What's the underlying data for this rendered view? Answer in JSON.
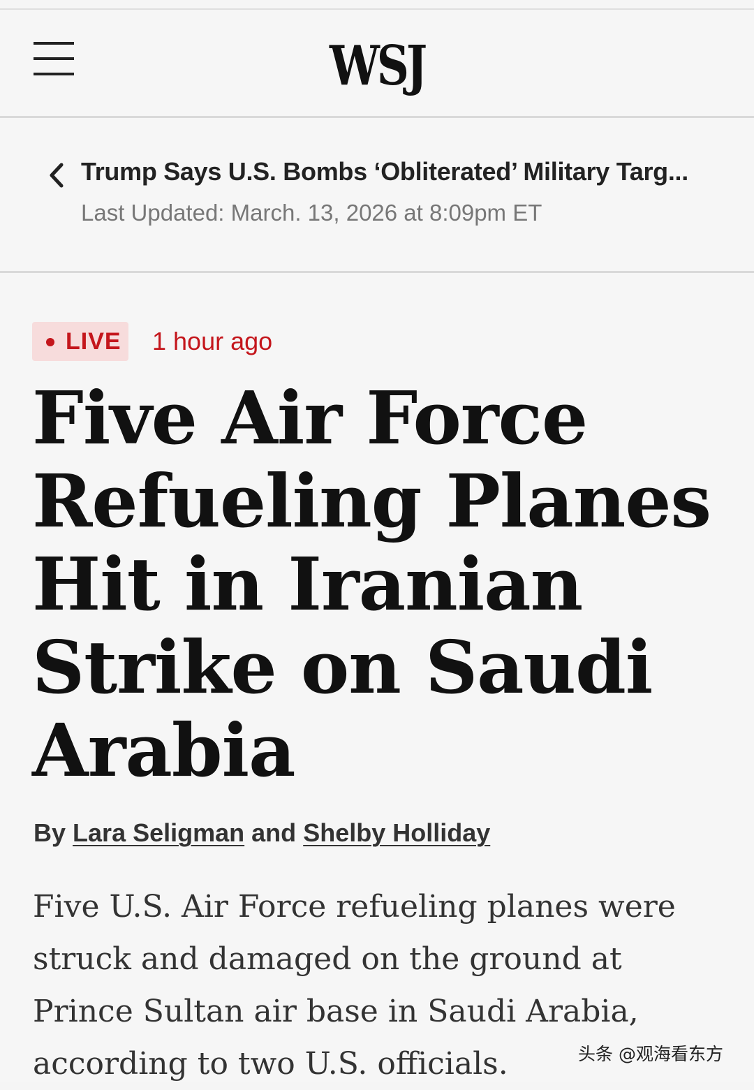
{
  "header": {
    "logo": "WSJ",
    "menu_icon": "hamburger-menu-icon"
  },
  "back_bar": {
    "icon": "chevron-left-icon",
    "title": "Trump Says U.S. Bombs ‘Obliterated’ Military Targ...",
    "updated": "Last Updated: March. 13, 2026 at 8:09pm ET"
  },
  "article": {
    "live_label": "LIVE",
    "time_ago": "1 hour ago",
    "headline": "Five Air Force Refueling Planes Hit in Iranian Strike on Saudi Arabia",
    "byline": {
      "prefix": "By",
      "author1": "Lara Seligman",
      "joiner": "and",
      "author2": "Shelby Holliday"
    },
    "lede": "Five U.S. Air Force refueling planes were struck and damaged on the ground at Prince Sultan air base in Saudi Arabia, according to two U.S. officials."
  },
  "watermark": "头条 @观海看东方",
  "colors": {
    "live_red": "#c4161c",
    "live_bg": "#f7dcdc",
    "background": "#f6f6f6"
  }
}
